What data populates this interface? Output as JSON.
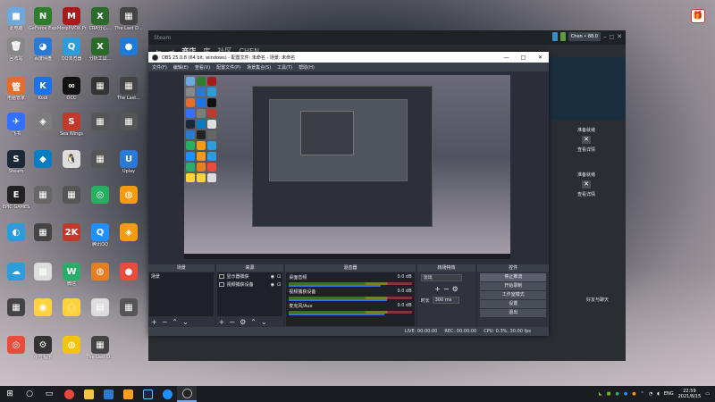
{
  "desktop": {
    "icons": [
      {
        "label": "此电脑",
        "color": "#6fa8dc",
        "glyph": "■"
      },
      {
        "label": "GeForce Experience",
        "color": "#2d7d2d",
        "glyph": "N"
      },
      {
        "label": "MorphVOX Pro",
        "color": "#a61c1c",
        "glyph": "M"
      },
      {
        "label": "CRA分心...",
        "color": "#2c6a2c",
        "glyph": "X"
      },
      {
        "label": "The Last D...",
        "color": "#444",
        "glyph": "▦"
      },
      {
        "label": "回收站",
        "color": "#888",
        "glyph": "🗑"
      },
      {
        "label": "百度网盘",
        "color": "#2a7ad5",
        "glyph": "◕"
      },
      {
        "label": "QQ浏览器",
        "color": "#2d9cdb",
        "glyph": "Q"
      },
      {
        "label": "分析工具...",
        "color": "#2c6a2c",
        "glyph": "X"
      },
      {
        "label": "",
        "color": "#1e7bd7",
        "glyph": "●"
      },
      {
        "label": "电脑管家",
        "color": "#e46c2c",
        "glyph": "管"
      },
      {
        "label": "Kodi",
        "color": "#1a73e8",
        "glyph": "K"
      },
      {
        "label": "OCC",
        "color": "#111",
        "glyph": "∞"
      },
      {
        "label": "",
        "color": "#333",
        "glyph": "▦"
      },
      {
        "label": "The Last...",
        "color": "#444",
        "glyph": "▦"
      },
      {
        "label": "飞书",
        "color": "#3370ff",
        "glyph": "✈"
      },
      {
        "label": "",
        "color": "#7d7d7d",
        "glyph": "◈"
      },
      {
        "label": "Sea Wings",
        "color": "#c0392b",
        "glyph": "S"
      },
      {
        "label": "",
        "color": "#555",
        "glyph": "▦"
      },
      {
        "label": "",
        "color": "#555",
        "glyph": "▦"
      },
      {
        "label": "Steam",
        "color": "#1b2838",
        "glyph": "S"
      },
      {
        "label": "",
        "color": "#0a7cc1",
        "glyph": "◆"
      },
      {
        "label": "",
        "color": "#ddd",
        "glyph": "🐧"
      },
      {
        "label": "",
        "color": "#555",
        "glyph": "▦"
      },
      {
        "label": "Uplay",
        "color": "#2a7ad5",
        "glyph": "U"
      },
      {
        "label": "EPIC GAMES",
        "color": "#222",
        "glyph": "E"
      },
      {
        "label": "",
        "color": "#666",
        "glyph": "▦"
      },
      {
        "label": "",
        "color": "#555",
        "glyph": "▦"
      },
      {
        "label": "",
        "color": "#27ae60",
        "glyph": "◎"
      },
      {
        "label": "",
        "color": "#f39c12",
        "glyph": "◍"
      },
      {
        "label": "",
        "color": "#2d9cdb",
        "glyph": "◐"
      },
      {
        "label": "",
        "color": "#444",
        "glyph": "▦"
      },
      {
        "label": "",
        "color": "#c0392b",
        "glyph": "2K"
      },
      {
        "label": "腾讯QQ",
        "color": "#1e90ff",
        "glyph": "Q"
      },
      {
        "label": "",
        "color": "#f39c12",
        "glyph": "◈"
      },
      {
        "label": "",
        "color": "#2d9cdb",
        "glyph": "☁"
      },
      {
        "label": "",
        "color": "#ddd",
        "glyph": "▦"
      },
      {
        "label": "微信",
        "color": "#2aae67",
        "glyph": "W"
      },
      {
        "label": "",
        "color": "#e67e22",
        "glyph": "◍"
      },
      {
        "label": "",
        "color": "#e74c3c",
        "glyph": "●"
      },
      {
        "label": "",
        "color": "#444",
        "glyph": "▦"
      },
      {
        "label": "",
        "color": "#ffd23f",
        "glyph": "◉"
      },
      {
        "label": "",
        "color": "#ffd23f",
        "glyph": "◌"
      },
      {
        "label": "",
        "color": "#ddd",
        "glyph": "▤"
      },
      {
        "label": "",
        "color": "#555",
        "glyph": "▦"
      },
      {
        "label": "",
        "color": "#e74c3c",
        "glyph": "◎"
      },
      {
        "label": "小号程序",
        "color": "#333",
        "glyph": "⚙"
      },
      {
        "label": "",
        "color": "#f1c40f",
        "glyph": "◍"
      },
      {
        "label": "The Last D...",
        "color": "#444",
        "glyph": "▦"
      }
    ],
    "right_icon": {
      "label": "",
      "glyph": "🎁"
    }
  },
  "launcher": {
    "brand": "Steam",
    "nav": [
      "商店",
      "库",
      "社区",
      "CHEN"
    ],
    "top_buttons": [
      "",
      ""
    ],
    "user": "Chen • 88.0",
    "panels": [
      {
        "title": "准备就绪",
        "sub": "查看详情"
      },
      {
        "title": "准备就绪",
        "sub": "查看详情"
      }
    ],
    "footer": "好友与聊天"
  },
  "obs": {
    "title": "OBS 25.0.8 (64 bit, windows) - 配置文件: 未命名 - 场景: 未命名",
    "menu": [
      "文件(F)",
      "编辑(E)",
      "查看(V)",
      "配置文件(P)",
      "场景集合(S)",
      "工具(T)",
      "帮助(H)"
    ],
    "docks": {
      "scenes": {
        "title": "场景",
        "items": [
          "场景"
        ]
      },
      "sources": {
        "title": "来源",
        "items": [
          "显示器捕获",
          "视频捕获设备"
        ]
      },
      "mixer": {
        "title": "混音器",
        "rows": [
          {
            "name": "桌面音频",
            "db": "0.0 dB",
            "level": 0.75
          },
          {
            "name": "视频捕获设备",
            "db": "0.0 dB",
            "level": 0.8
          },
          {
            "name": "麦克风/Aux",
            "db": "0.0 dB",
            "level": 0.78
          }
        ]
      },
      "transitions": {
        "title": "转场特效",
        "select": "淡出",
        "duration_label": "时长",
        "duration": "300 ms"
      },
      "controls": {
        "title": "控件",
        "buttons": [
          "停止推流",
          "开始录制",
          "工作室模式",
          "设置",
          "退出"
        ]
      }
    },
    "status": {
      "live": "LIVE: 00:00:00",
      "rec": "REC: 00:00:00",
      "cpu": "CPU: 0.3%, 30.00 fps"
    }
  },
  "taskbar": {
    "tray_lang": "ENG",
    "time": "22:59",
    "date": "2021/8/15"
  }
}
